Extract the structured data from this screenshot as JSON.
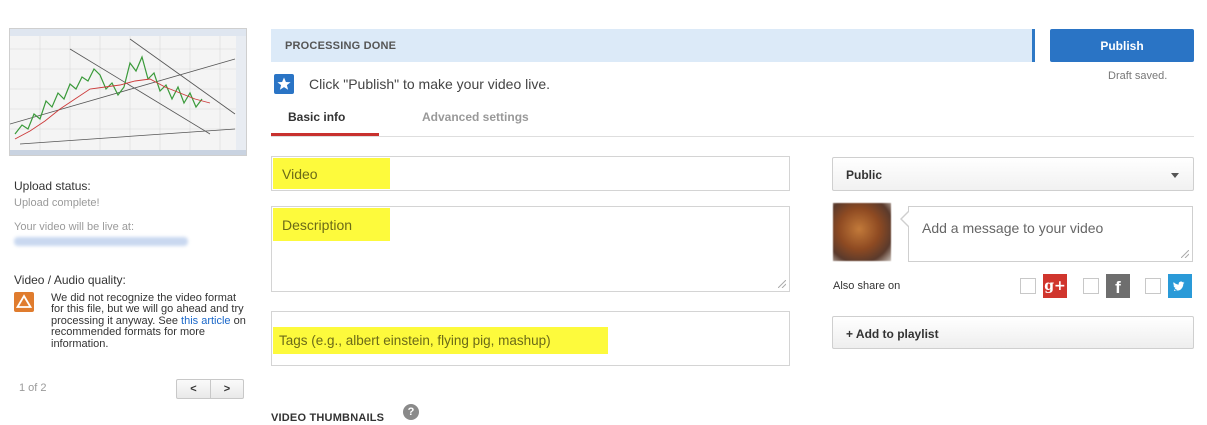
{
  "left": {
    "upload_status_label": "Upload status:",
    "upload_status_value": "Upload complete!",
    "live_at_label": "Your video will be live at:",
    "quality_label": "Video / Audio quality:",
    "warning_text_1": "We did not recognize the video format for this file, but we will go ahead and try processing it anyway. See ",
    "warning_link": "this article",
    "warning_text_2": " on recommended formats for more information.",
    "pager_text": "1 of 2",
    "prev_label": "<",
    "next_label": ">"
  },
  "banner": {
    "status": "PROCESSING DONE",
    "publish_label": "Publish",
    "draft_status": "Draft saved."
  },
  "hint": "Click \"Publish\" to make your video live.",
  "tabs": [
    {
      "label": "Basic info",
      "active": true
    },
    {
      "label": "Advanced settings",
      "active": false
    }
  ],
  "form": {
    "title_placeholder": "Video",
    "description_placeholder": "Description",
    "tags_placeholder": "Tags (e.g., albert einstein, flying pig, mashup)"
  },
  "right": {
    "privacy_value": "Public",
    "message_placeholder": "Add a message to your video",
    "share_label": "Also share on",
    "add_playlist_label": "+ Add to playlist"
  },
  "thumbnails_title": "VIDEO THUMBNAILS",
  "colors": {
    "accent": "#2a74c5",
    "banner_bg": "#dceaf8",
    "highlight": "#fdfa3c",
    "tab_active": "#c8312e",
    "warning": "#e07c2e"
  },
  "icons": [
    "star-icon",
    "warning-icon",
    "google-plus-icon",
    "facebook-icon",
    "twitter-icon",
    "help-icon",
    "chevron-down-icon"
  ]
}
